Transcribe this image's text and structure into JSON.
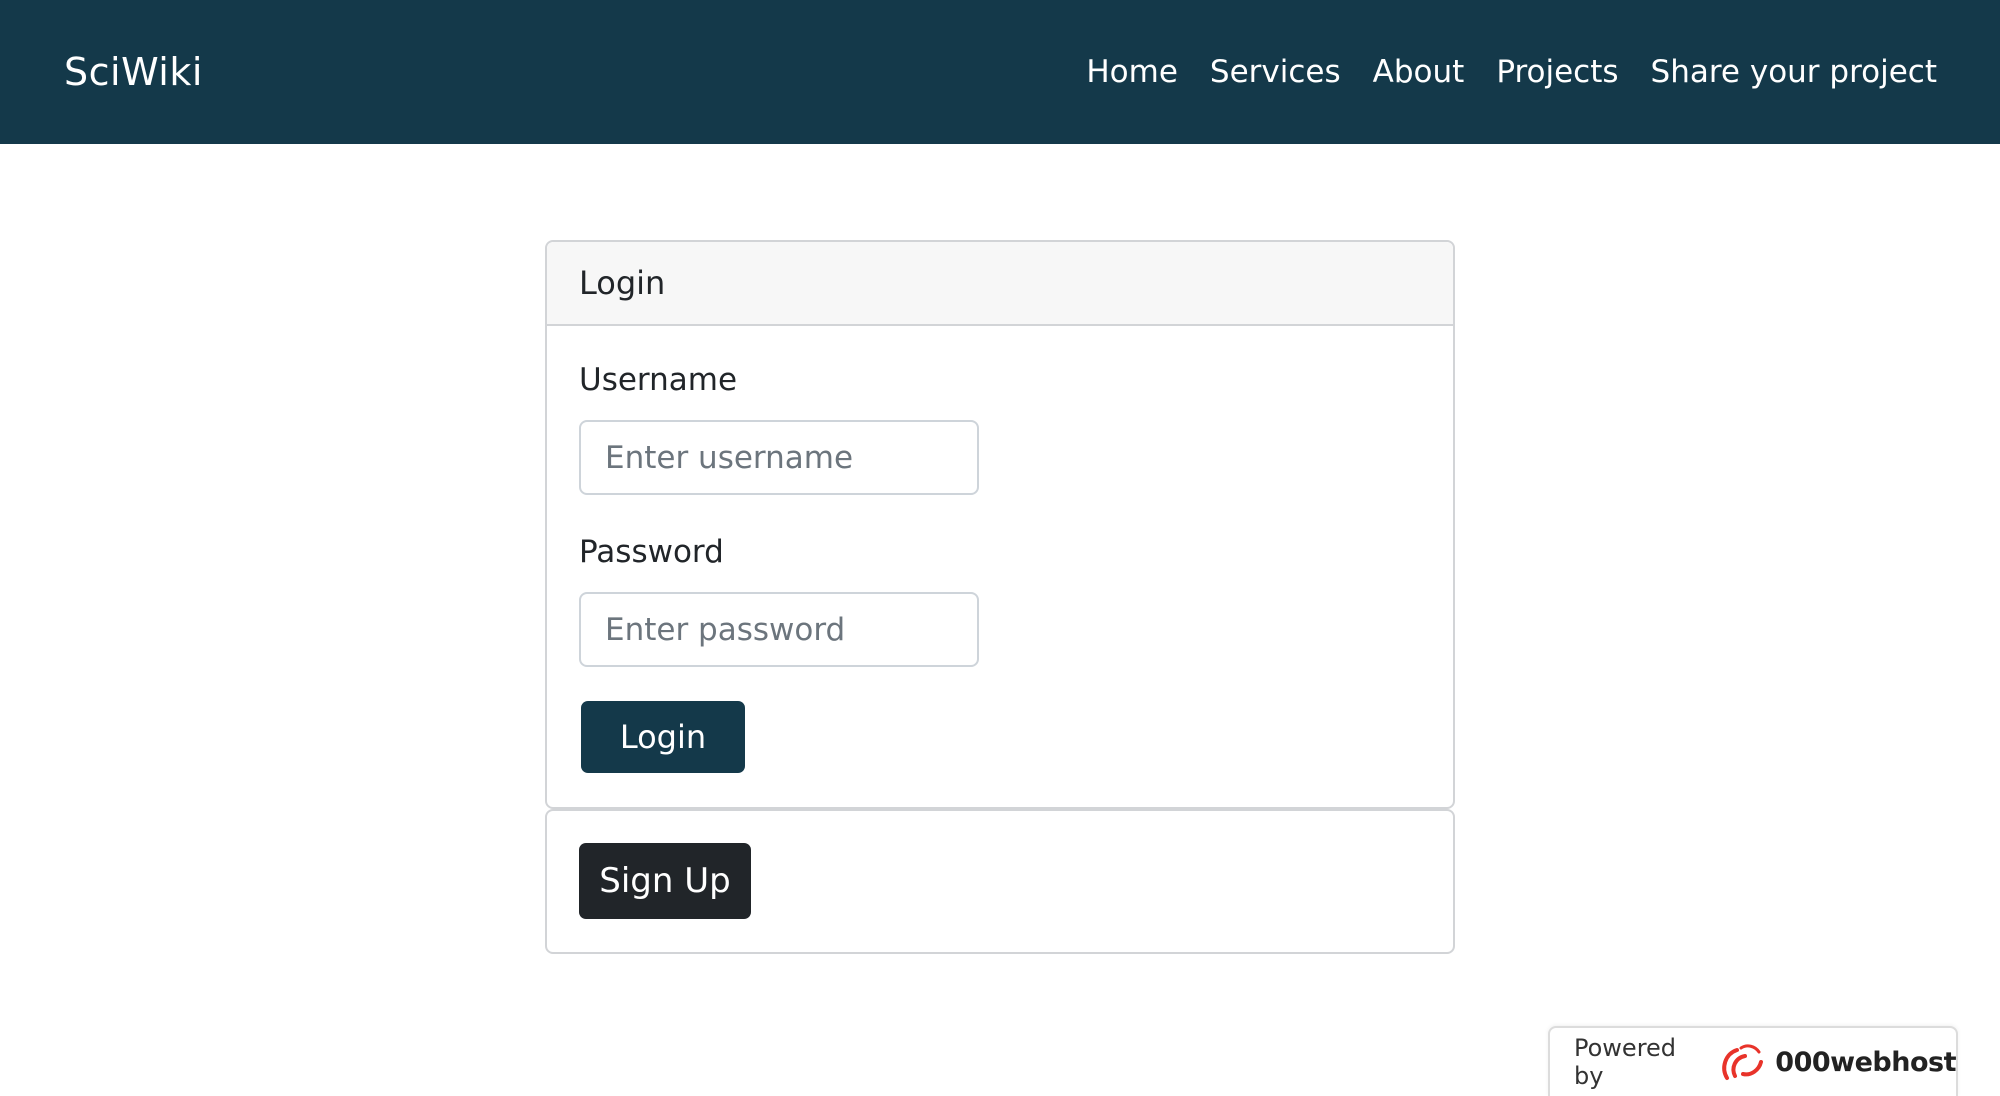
{
  "navbar": {
    "brand": "SciWiki",
    "links": [
      "Home",
      "Services",
      "About",
      "Projects",
      "Share your project"
    ],
    "bg_color": "#14394a"
  },
  "login_card": {
    "header": "Login",
    "username_label": "Username",
    "username_placeholder": "Enter username",
    "username_value": "",
    "password_label": "Password",
    "password_placeholder": "Enter password",
    "password_value": "",
    "login_button": "Login",
    "login_button_color": "#14394a"
  },
  "signup_card": {
    "signup_button": "Sign Up",
    "signup_button_color": "#212529"
  },
  "footer_badge": {
    "powered_label": "Powered by",
    "brand": "000webhost",
    "logo_icon": "000webhost-swirl-icon",
    "logo_color": "#e8332a"
  }
}
